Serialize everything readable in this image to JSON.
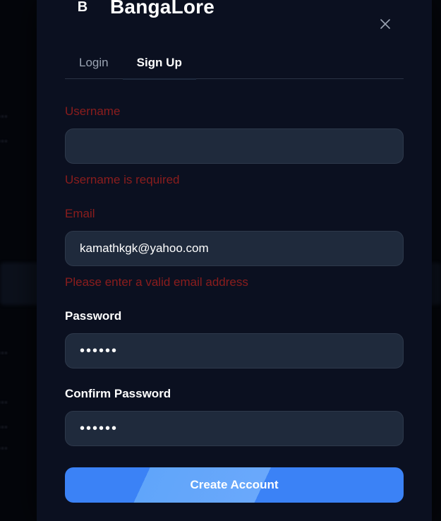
{
  "brand": {
    "logo_letter": "B",
    "name": "BangaLore"
  },
  "tabs": [
    {
      "label": "Login",
      "active": false
    },
    {
      "label": "Sign Up",
      "active": true
    }
  ],
  "form": {
    "username": {
      "label": "Username",
      "value": "",
      "error": "Username is required"
    },
    "email": {
      "label": "Email",
      "value": "kamathkgk@yahoo.com",
      "error": "Please enter a valid email address"
    },
    "password": {
      "label": "Password",
      "value": "••••••"
    },
    "confirm_password": {
      "label": "Confirm Password",
      "value": "••••••"
    },
    "submit_label": "Create Account"
  },
  "colors": {
    "modal_bg": "#0b1020",
    "input_bg": "#1f2a3c",
    "error": "#8b1d1d",
    "accent": "#3b82f6"
  },
  "icons": {
    "close": "close-icon"
  }
}
